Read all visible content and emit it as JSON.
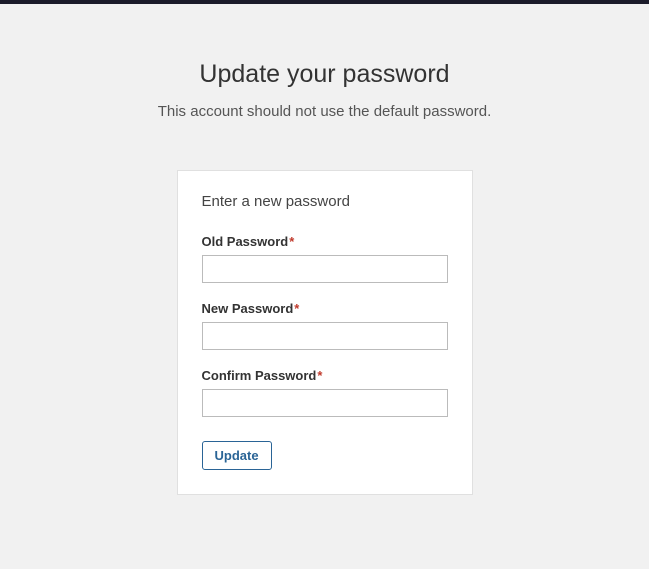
{
  "header": {
    "title": "Update your password",
    "subtitle": "This account should not use the default password."
  },
  "form": {
    "heading": "Enter a new password",
    "required_marker": "*",
    "fields": {
      "old_password": {
        "label": "Old Password",
        "value": ""
      },
      "new_password": {
        "label": "New Password",
        "value": ""
      },
      "confirm_password": {
        "label": "Confirm Password",
        "value": ""
      }
    },
    "submit_label": "Update"
  }
}
